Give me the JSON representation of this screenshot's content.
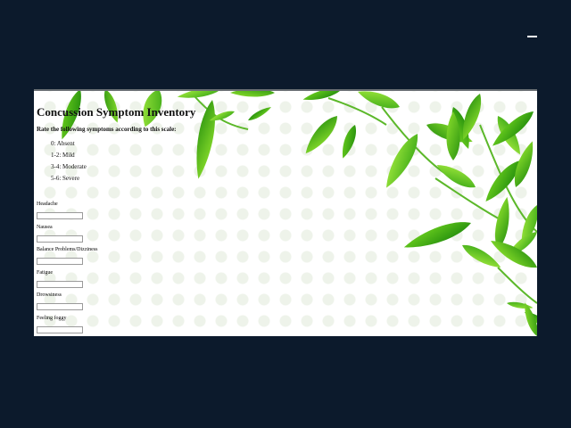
{
  "form": {
    "title": "Concussion Symptom Inventory",
    "instruction": "Rate the following symptoms according to this scale:",
    "scale": [
      {
        "label": "0: Absent"
      },
      {
        "label": "1-2: Mild"
      },
      {
        "label": "3-4: Moderate"
      },
      {
        "label": "5-6: Severe"
      }
    ],
    "fields": [
      {
        "label": "Headache",
        "value": "",
        "placeholder": ""
      },
      {
        "label": "Nausea",
        "value": "",
        "placeholder": ""
      },
      {
        "label": "Balance Problems/Dizziness",
        "value": "",
        "placeholder": ""
      },
      {
        "label": "Fatigue",
        "value": "",
        "placeholder": ""
      },
      {
        "label": "Drowsiness",
        "value": "",
        "placeholder": ""
      },
      {
        "label": "Feeling foggy",
        "value": "",
        "placeholder": ""
      }
    ]
  },
  "colors": {
    "page_background": "#0c1a2c",
    "leaf_light": "#7ed321",
    "leaf_dark": "#2e9a12",
    "vein": "#d9f5b0"
  },
  "icons": [
    "minimize-icon"
  ]
}
